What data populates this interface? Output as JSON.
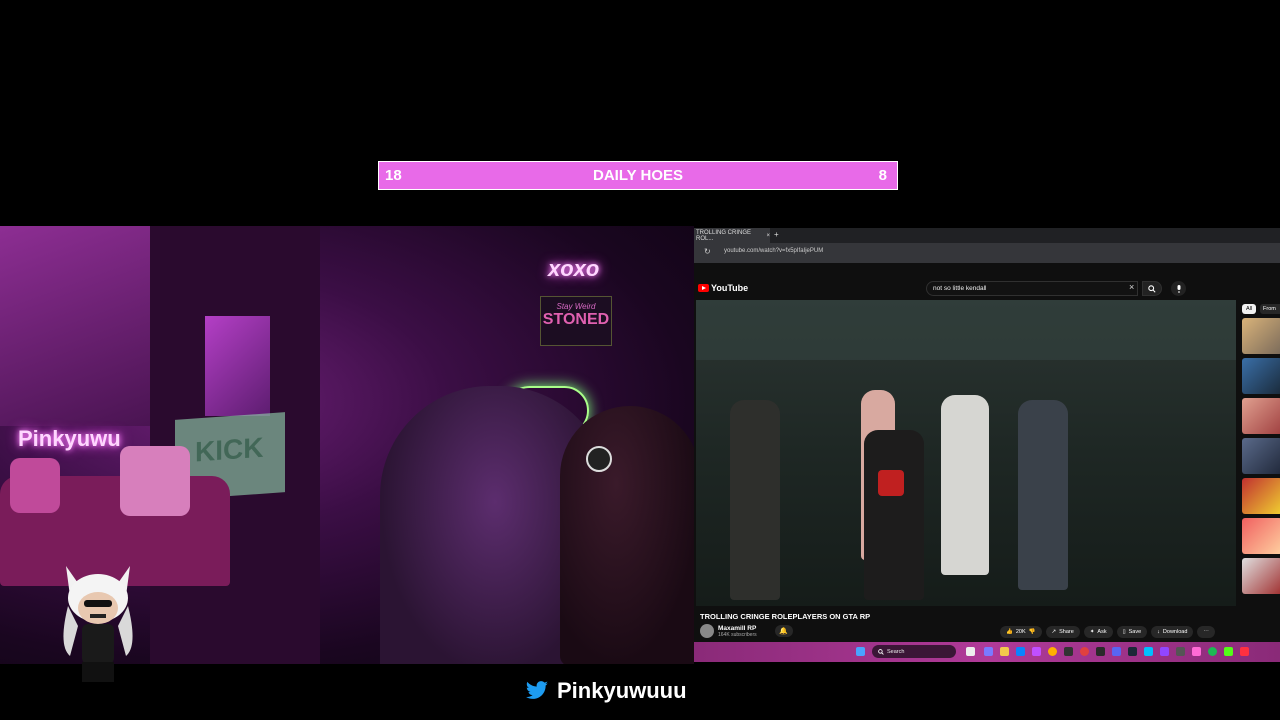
{
  "counter": {
    "left": "18",
    "title": "DAILY HOES",
    "right": "8",
    "color": "#e86ae8"
  },
  "webcam": {
    "signs": {
      "xoxo": "xoxo",
      "stoned_top": "Stay Weird",
      "stoned": "STONED",
      "pinky": "Pinkyuwu",
      "kick": "KICK"
    }
  },
  "browser": {
    "tab_title": "TROLLING CRINGE ROL...",
    "tab_close": "×",
    "tab_new": "+",
    "url": "youtube.com/watch?v=fx5pIfaIjePUM",
    "youtube_logo": "YouTube",
    "search_value": "not so little kendall",
    "video_title": "TROLLING CRINGE ROLEPLAYERS ON GTA RP",
    "channel_name": "Maxamill RP",
    "subscribers": "164K subscribers",
    "actions": {
      "likes": "20K",
      "share": "Share",
      "ask": "Ask",
      "save": "Save",
      "download": "Download"
    },
    "chips": {
      "all": "All",
      "from": "From"
    },
    "taskbar_search": "Search"
  },
  "twitter": {
    "handle": "Pinkyuwuuu",
    "brand_color": "#1d9bf0"
  }
}
